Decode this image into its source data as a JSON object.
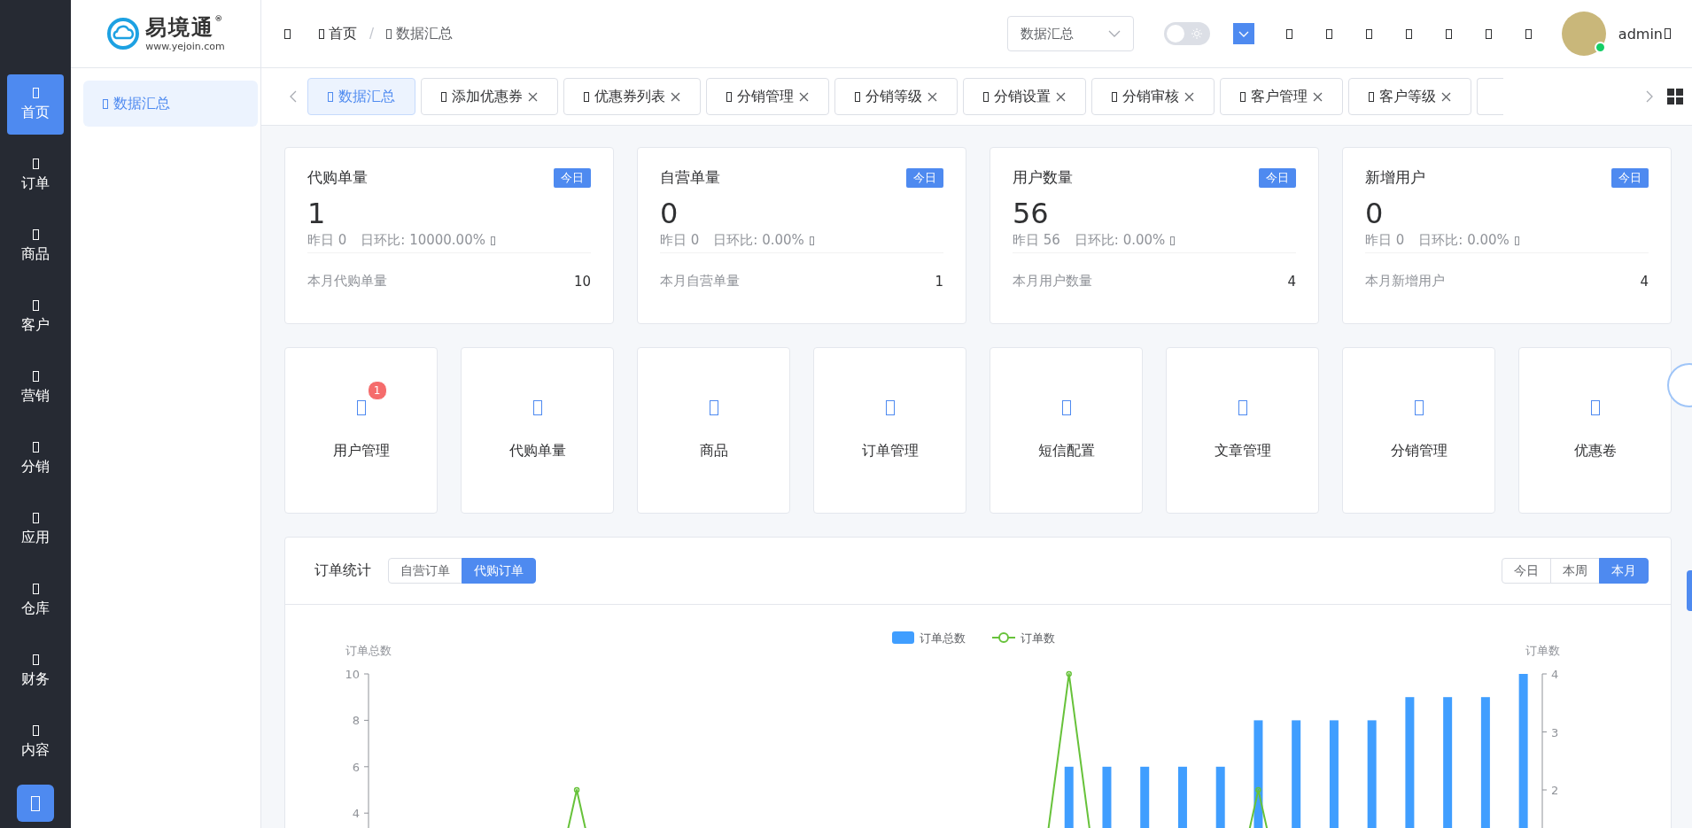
{
  "logo": {
    "name": "易境通",
    "registered": "®",
    "url": "www.yejoin.com"
  },
  "sidebar": {
    "items": [
      {
        "label": "首页",
        "selected": true
      },
      {
        "label": "订单",
        "selected": false
      },
      {
        "label": "商品",
        "selected": false
      },
      {
        "label": "客户",
        "selected": false
      },
      {
        "label": "营销",
        "selected": false
      },
      {
        "label": "分销",
        "selected": false
      },
      {
        "label": "应用",
        "selected": false
      },
      {
        "label": "仓库",
        "selected": false
      },
      {
        "label": "财务",
        "selected": false
      },
      {
        "label": "内容",
        "selected": false
      }
    ]
  },
  "submenu": {
    "items": [
      {
        "label": "数据汇总",
        "selected": true
      }
    ]
  },
  "breadcrumb": {
    "items": [
      "首页",
      "数据汇总"
    ],
    "separator": "/"
  },
  "header": {
    "select": {
      "value": "数据汇总"
    },
    "theme_switch": {
      "on": false
    },
    "user": "admin",
    "online": true
  },
  "tabs": [
    {
      "label": "数据汇总",
      "selected": true
    },
    {
      "label": "添加优惠券",
      "selected": false
    },
    {
      "label": "优惠券列表",
      "selected": false
    },
    {
      "label": "分销管理",
      "selected": false
    },
    {
      "label": "分销等级",
      "selected": false
    },
    {
      "label": "分销设置",
      "selected": false
    },
    {
      "label": "分销审核",
      "selected": false
    },
    {
      "label": "客户管理",
      "selected": false
    },
    {
      "label": "客户等级",
      "selected": false
    }
  ],
  "stats": [
    {
      "title": "代购单量",
      "badge": "今日",
      "value": "1",
      "yesterday": "昨日 0",
      "ratio": "日环比: 10000.00%",
      "month_label": "本月代购单量",
      "month_value": "10"
    },
    {
      "title": "自营单量",
      "badge": "今日",
      "value": "0",
      "yesterday": "昨日 0",
      "ratio": "日环比: 0.00%",
      "month_label": "本月自营单量",
      "month_value": "1"
    },
    {
      "title": "用户数量",
      "badge": "今日",
      "value": "56",
      "yesterday": "昨日 56",
      "ratio": "日环比: 0.00%",
      "month_label": "本月用户数量",
      "month_value": "4"
    },
    {
      "title": "新增用户",
      "badge": "今日",
      "value": "0",
      "yesterday": "昨日 0",
      "ratio": "日环比: 0.00%",
      "month_label": "本月新增用户",
      "month_value": "4"
    }
  ],
  "shortcuts": [
    {
      "label": "用户管理",
      "count": "1"
    },
    {
      "label": "代购单量"
    },
    {
      "label": "商品"
    },
    {
      "label": "订单管理"
    },
    {
      "label": "短信配置"
    },
    {
      "label": "文章管理"
    },
    {
      "label": "分销管理"
    },
    {
      "label": "优惠卷"
    }
  ],
  "order_stats": {
    "title": "订单统计",
    "types": [
      {
        "label": "自营订单",
        "selected": false
      },
      {
        "label": "代购订单",
        "selected": true
      }
    ],
    "periods": [
      {
        "label": "今日",
        "selected": false
      },
      {
        "label": "本周",
        "selected": false
      },
      {
        "label": "本月",
        "selected": true
      }
    ],
    "chart": {
      "legend": [
        {
          "name": "订单总数",
          "kind": "bar",
          "color": "#409eff"
        },
        {
          "name": "订单数",
          "kind": "line",
          "color": "#67c23a"
        }
      ],
      "left_title": "订单总数",
      "right_title": "订单数",
      "left_ticks": [
        "10",
        "8",
        "6",
        "4"
      ],
      "right_ticks": [
        "4",
        "3",
        "2"
      ]
    }
  }
}
